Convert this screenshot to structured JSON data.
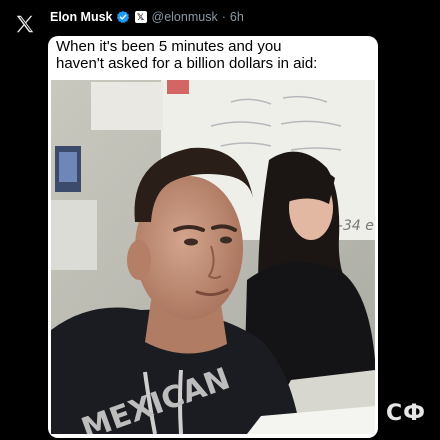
{
  "author": {
    "name": "Elon Musk",
    "badge": "𝕏",
    "handle": "@elonmusk",
    "separator": "·",
    "time": "6h"
  },
  "post": {
    "caption_lines": [
      "When it's been 5 minutes and you",
      "haven't asked for a billion dollars in aid:"
    ],
    "image": {
      "description_icon": "meme-photo",
      "shirt_text": "MEXICAN",
      "whiteboard_text": "4-34 e"
    }
  },
  "watermark": "СФ"
}
